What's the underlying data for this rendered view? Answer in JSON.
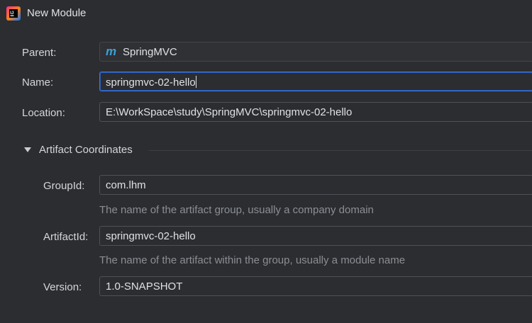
{
  "window": {
    "title": "New Module"
  },
  "form": {
    "parent": {
      "label": "Parent:",
      "value": "SpringMVC",
      "icon": "maven-m-icon"
    },
    "name": {
      "label": "Name:",
      "value": "springmvc-02-hello"
    },
    "location": {
      "label": "Location:",
      "value": "E:\\WorkSpace\\study\\SpringMVC\\springmvc-02-hello"
    }
  },
  "artifact": {
    "section_title": "Artifact Coordinates",
    "group_id": {
      "label": "GroupId:",
      "value": "com.lhm",
      "hint": "The name of the artifact group, usually a company domain"
    },
    "artifact_id": {
      "label": "ArtifactId:",
      "value": "springmvc-02-hello",
      "hint": "The name of the artifact within the group, usually a module name"
    },
    "version": {
      "label": "Version:",
      "value": "1.0-SNAPSHOT"
    }
  },
  "colors": {
    "background": "#2b2d30",
    "focus_border": "#3574f0",
    "maven_icon": "#3d9fd6",
    "hint_text": "#8b8e94"
  }
}
